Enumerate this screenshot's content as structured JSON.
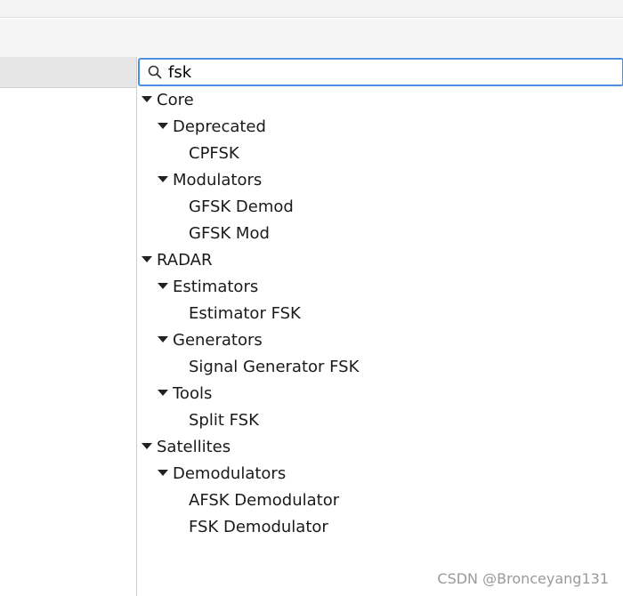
{
  "search": {
    "value": "fsk",
    "icon": "search-icon"
  },
  "tree": {
    "core": {
      "label": "Core",
      "deprecated": {
        "label": "Deprecated",
        "items": [
          "CPFSK"
        ]
      },
      "modulators": {
        "label": "Modulators",
        "items": [
          "GFSK Demod",
          "GFSK Mod"
        ]
      }
    },
    "radar": {
      "label": "RADAR",
      "estimators": {
        "label": "Estimators",
        "items": [
          "Estimator FSK"
        ]
      },
      "generators": {
        "label": "Generators",
        "items": [
          "Signal Generator FSK"
        ]
      },
      "tools": {
        "label": "Tools",
        "items": [
          "Split FSK"
        ]
      }
    },
    "satellites": {
      "label": "Satellites",
      "demodulators": {
        "label": "Demodulators",
        "items": [
          "AFSK Demodulator",
          "FSK Demodulator"
        ]
      }
    }
  },
  "watermark": "CSDN @Bronceyang131",
  "colors": {
    "focus_border": "#4a90e2",
    "toolbar_bg": "#f5f5f5",
    "panel_header_bg": "#e6e6e6",
    "watermark": "#9a9a9a"
  }
}
